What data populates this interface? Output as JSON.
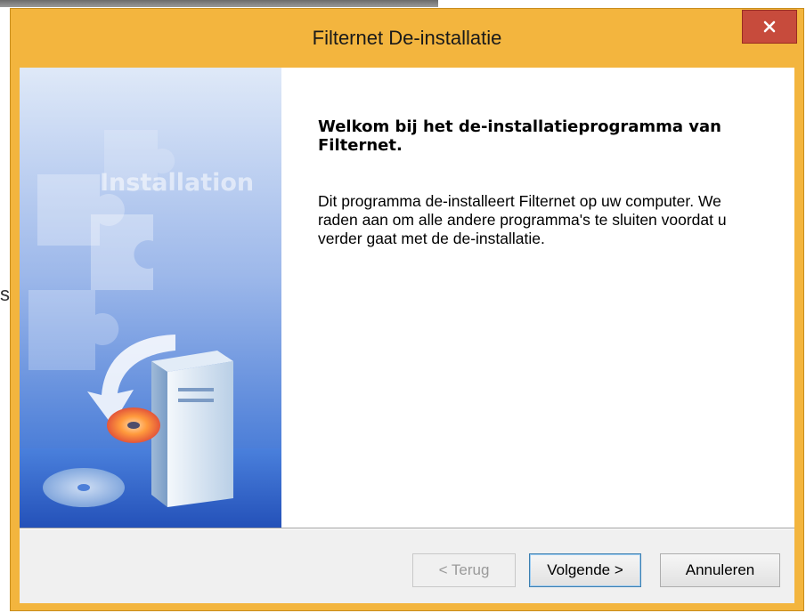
{
  "background": {
    "fragment_text": "s"
  },
  "window": {
    "title": "Filternet De-installatie",
    "close_glyph": "×"
  },
  "side_image": {
    "label": "Installation",
    "icon": "computer-disc-install-icon"
  },
  "content": {
    "heading": "Welkom bij het de-installatieprogramma van Filternet.",
    "body": "Dit programma de-installeert Filternet op uw computer. We raden aan om alle andere programma's te sluiten voordat u verder gaat met de de-installatie."
  },
  "buttons": {
    "back": "< Terug",
    "next": "Volgende >",
    "cancel": "Annuleren"
  },
  "colors": {
    "title_bar": "#f3b53e",
    "close_button": "#c74b3c",
    "side_panel_blue": "#3a6fd0"
  }
}
